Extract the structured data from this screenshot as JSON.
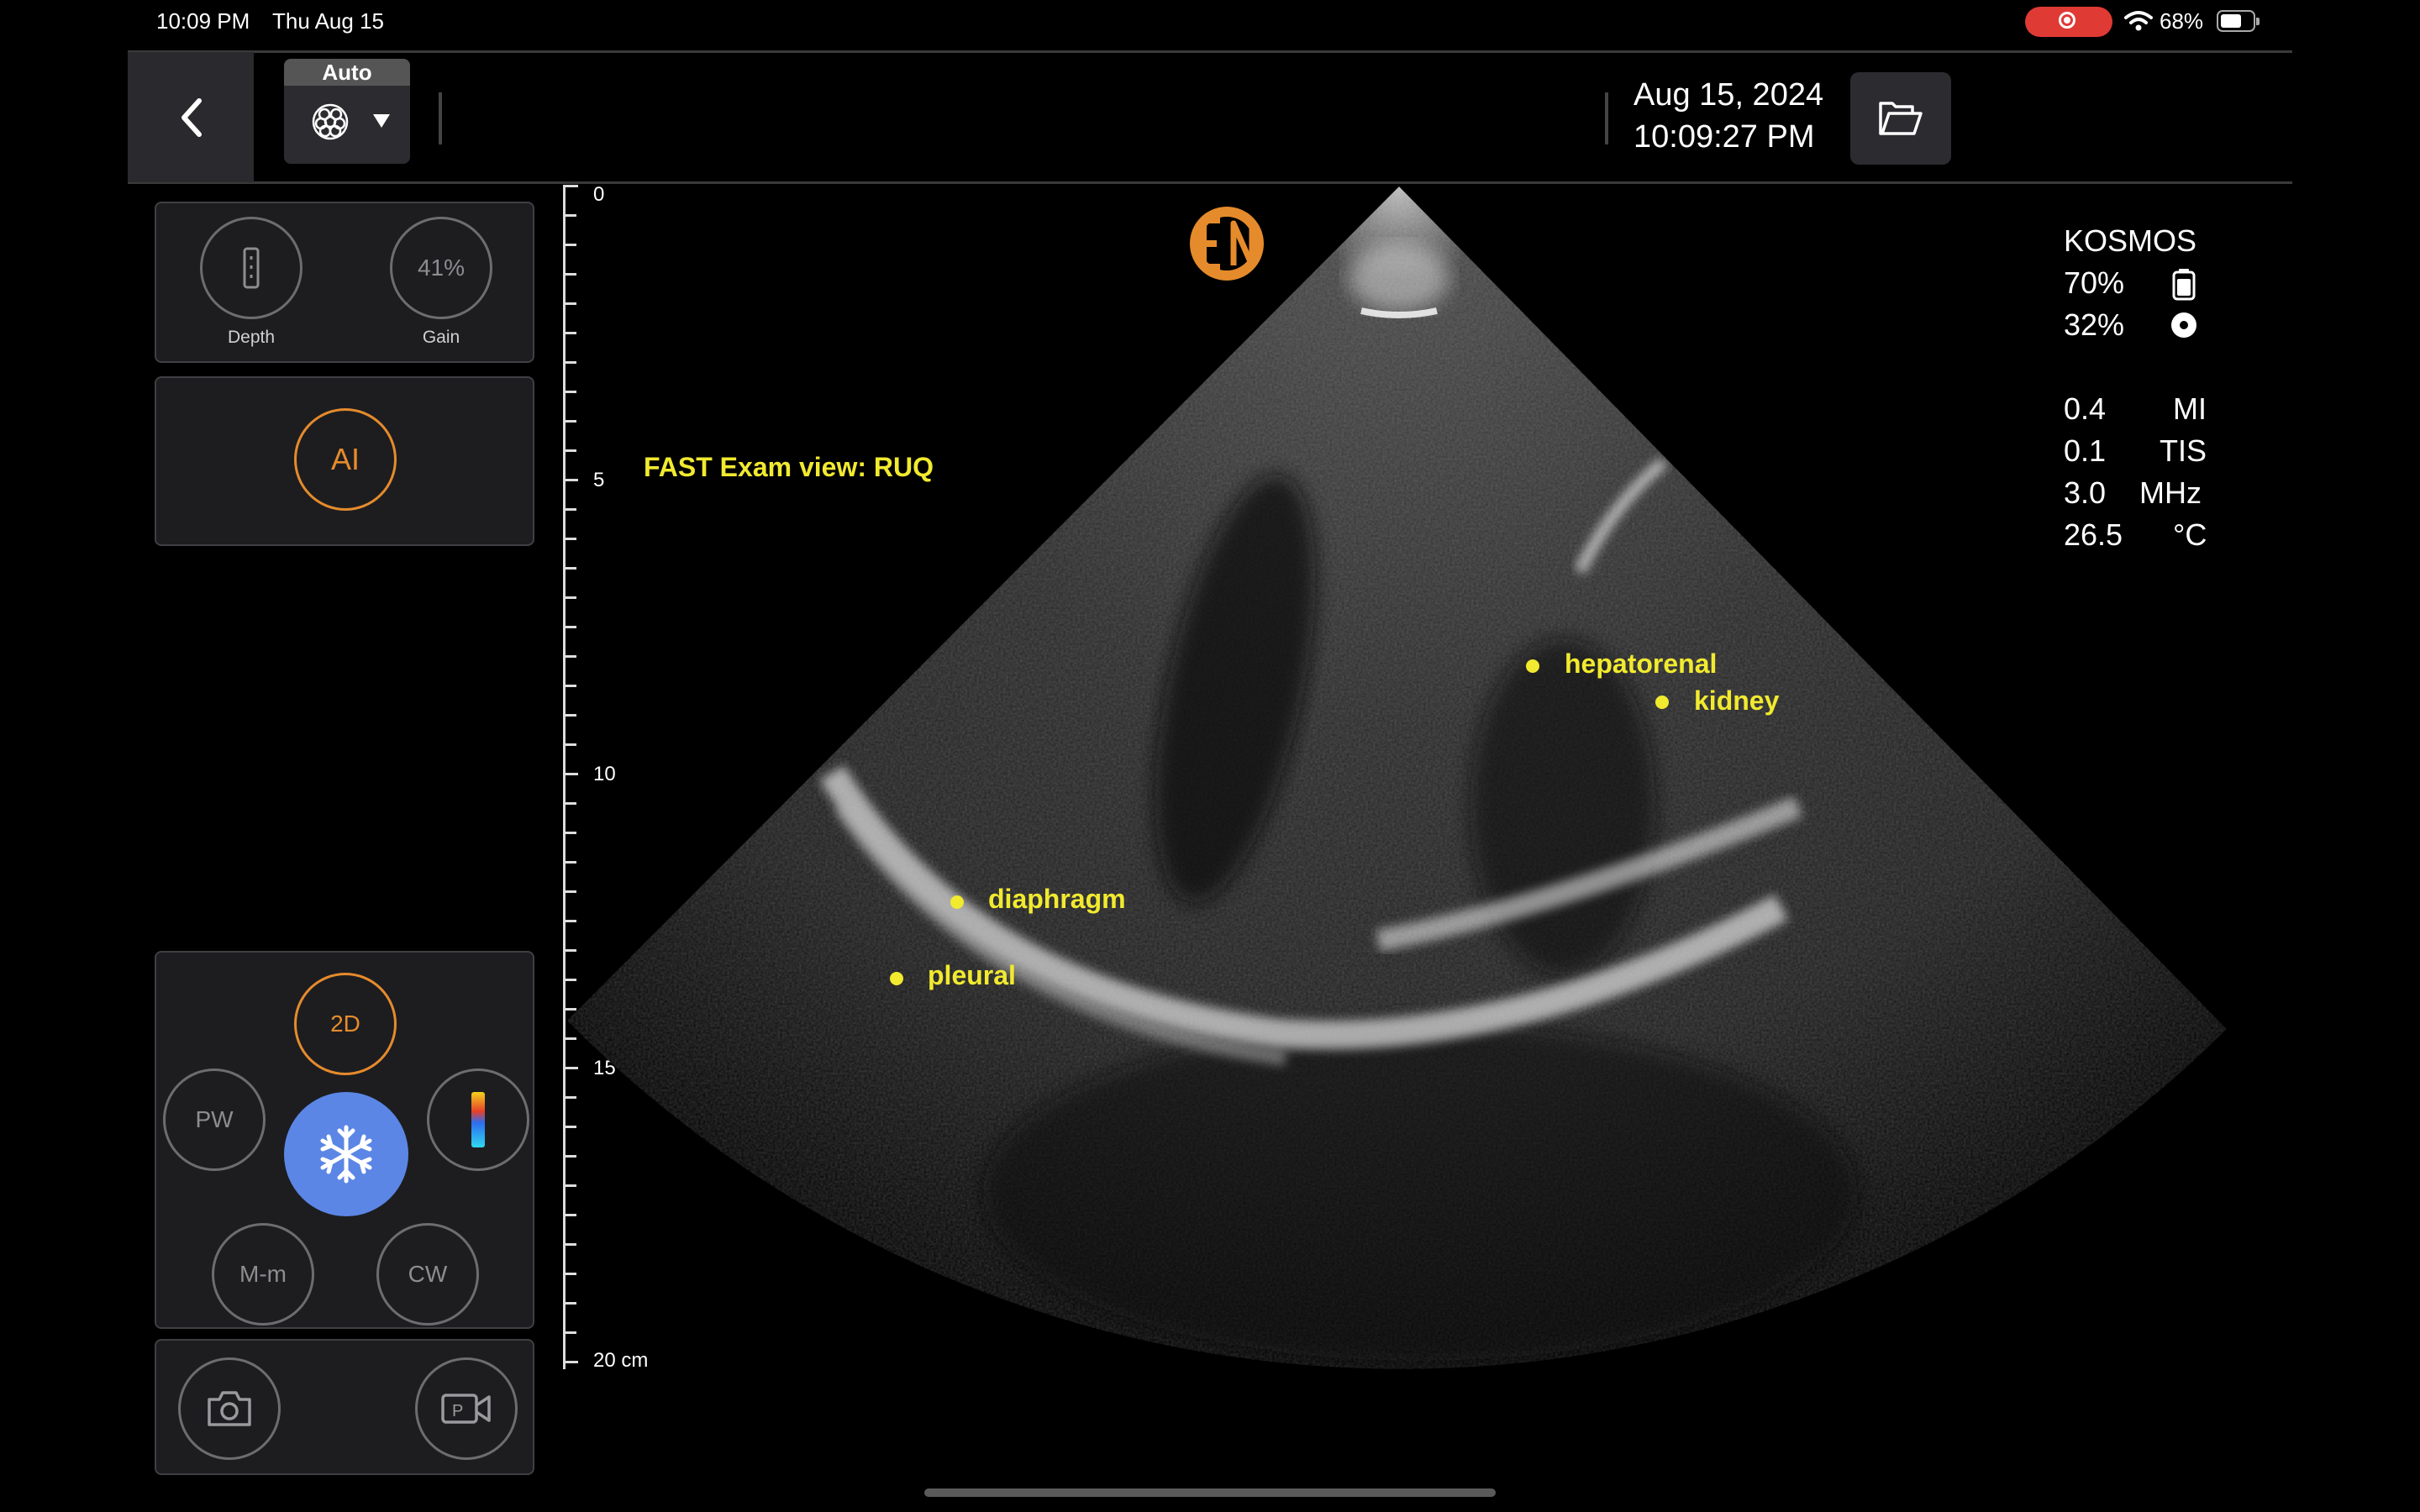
{
  "status_bar": {
    "time": "10:09 PM",
    "date": "Thu Aug 15",
    "battery": "68%",
    "battery_level": 0.68
  },
  "toolbar": {
    "preset_label": "Auto",
    "date": "Aug 15, 2024",
    "time": "10:09:27 PM"
  },
  "controls": {
    "depth_label": "Depth",
    "gain_value": "41%",
    "gain_label": "Gain",
    "ai_label": "AI",
    "modes": {
      "twod": "2D",
      "pw": "PW",
      "mm": "M-m",
      "cw": "CW"
    }
  },
  "ruler": {
    "labels": [
      "0",
      "5",
      "10",
      "15",
      "20 cm"
    ]
  },
  "image": {
    "exam_view": "FAST Exam view: RUQ",
    "annotations": [
      "hepatorenal",
      "kidney",
      "diaphragm",
      "pleural"
    ]
  },
  "info": {
    "device": "KOSMOS",
    "battery": "70%",
    "probe": "32%",
    "mi_value": "0.4",
    "mi_unit": "MI",
    "tis_value": "0.1",
    "tis_unit": "TIS",
    "freq_value": "3.0",
    "freq_unit": "MHz",
    "temp_value": "26.5",
    "temp_unit": "°C"
  },
  "colors": {
    "accent_orange": "#e58b2c",
    "label_yellow": "#f1ea2f",
    "freeze_blue": "#5b86e5"
  },
  "icons": [
    "back-chevron-icon",
    "probe-icon",
    "dropdown-triangle-icon",
    "folder-icon",
    "depth-icon",
    "snowflake-icon",
    "color-doppler-icon",
    "camera-icon",
    "video-record-icon",
    "logo-icon",
    "battery-icon",
    "wifi-icon",
    "record-icon"
  ]
}
